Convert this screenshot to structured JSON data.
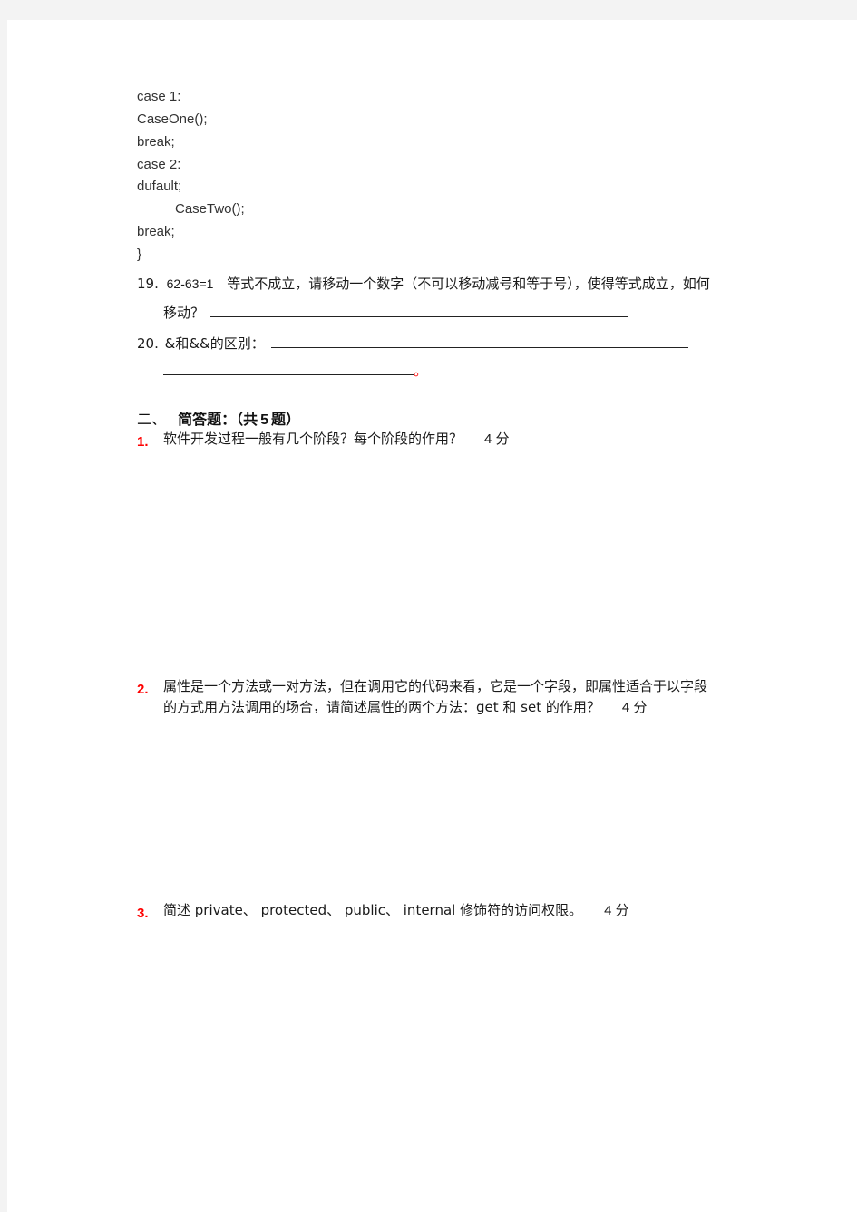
{
  "code_block": {
    "lines": [
      "case  1:",
      "CaseOne();",
      "break;",
      "case  2:",
      "dufault;",
      "CaseTwo();",
      "break;",
      "}"
    ]
  },
  "fill_in": {
    "q19": {
      "number": "19.",
      "expression": "62-63=1",
      "text_line1": "等式不成立，请移动一个数字（不可以移动减号和等于号），使得等式成立，如何",
      "text_line2": "移动？"
    },
    "q20": {
      "number": "20.",
      "text": "&和&&的区别：",
      "end_mark": "。"
    }
  },
  "section2": {
    "prefix": "二、",
    "title": "简答题：（共",
    "count": "5",
    "suffix": "题）"
  },
  "short_answers": [
    {
      "number": "1.",
      "line1": "软件开发过程一般有几个阶段？每个阶段的作用？",
      "points": "4 分"
    },
    {
      "number": "2.",
      "line1": "属性是一个方法或一对方法，但在调用它的代码来看，它是一个字段，即属性适合于以字段",
      "line2": "的方式用方法调用的场合，请简述属性的两个方法：get 和 set 的作用？",
      "points": "4 分"
    },
    {
      "number": "3.",
      "line1": "简述  private、  protected、  public、  internal  修饰符的访问权限。",
      "points": "4 分"
    }
  ],
  "colors": {
    "accent_red": "#ff0000",
    "page_bg": "#ffffff",
    "canvas_bg": "#f3f3f3"
  }
}
